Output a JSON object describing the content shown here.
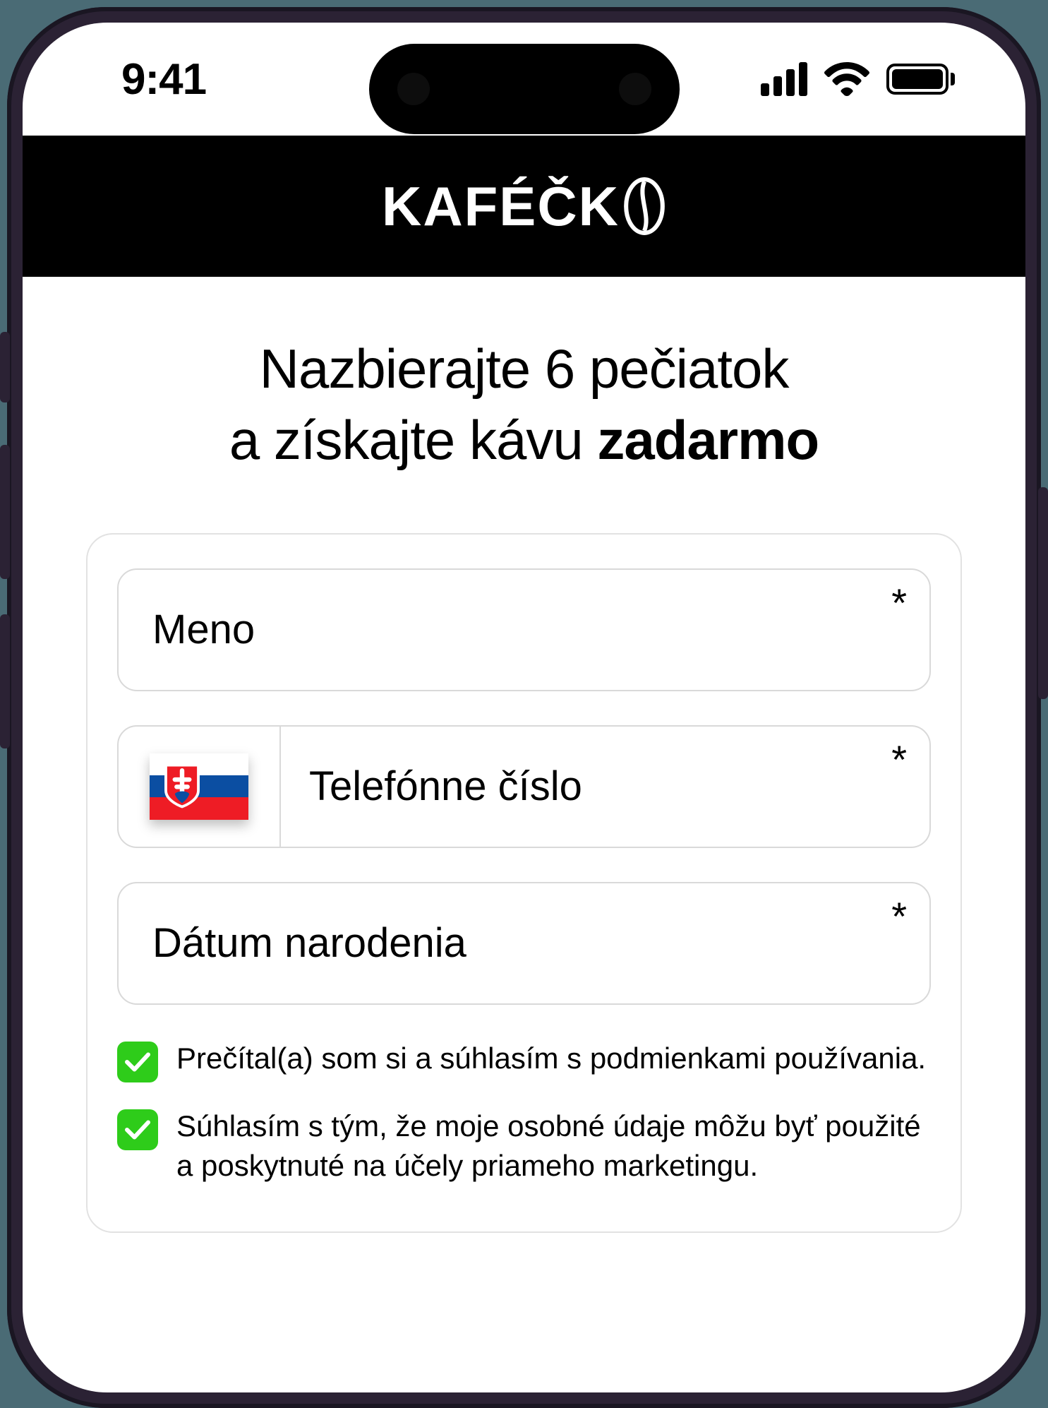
{
  "status": {
    "time": "9:41"
  },
  "header": {
    "brand": "KAFÉČK"
  },
  "headline": {
    "line1": "Nazbierajte 6 pečiatok",
    "line2_prefix": "a získajte kávu ",
    "line2_bold": "zadarmo"
  },
  "form": {
    "required_mark": "*",
    "name": {
      "placeholder": "Meno"
    },
    "phone": {
      "country": "SK",
      "placeholder": "Telefónne číslo"
    },
    "dob": {
      "placeholder": "Dátum narodenia"
    },
    "checks": {
      "terms": {
        "checked": true,
        "label": "Prečítal(a) som si a súhlasím s podmienkami používania."
      },
      "marketing": {
        "checked": true,
        "label": "Súhlasím s tým, že moje osobné údaje môžu byť použité a poskytnuté na účely priameho marketingu."
      }
    }
  }
}
